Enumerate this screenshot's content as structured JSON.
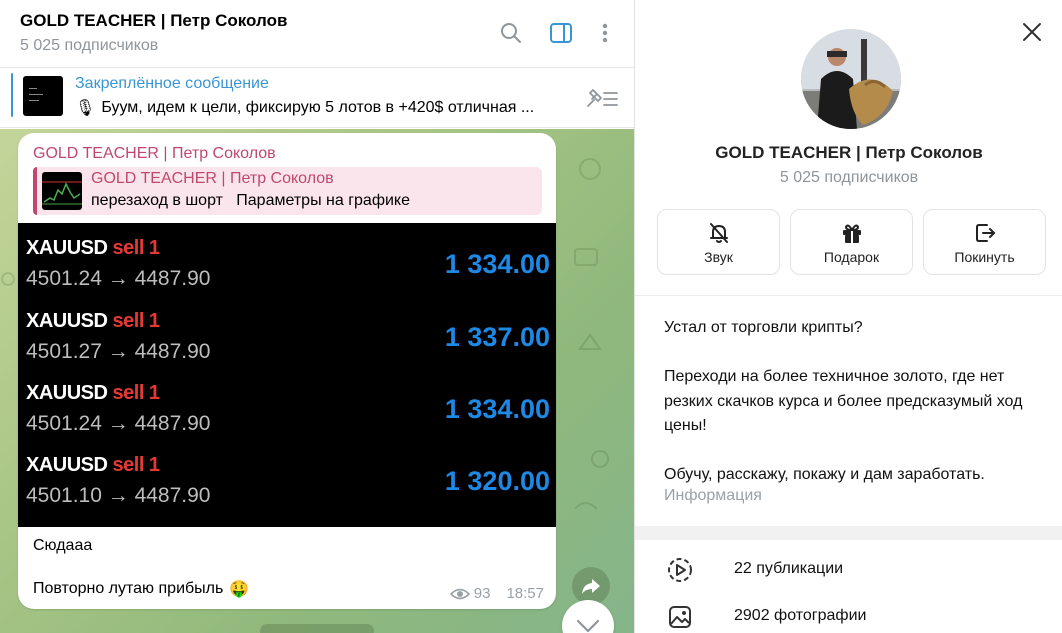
{
  "chat": {
    "title": "GOLD TEACHER | Петр Соколов",
    "subscribers": "5 025 подписчиков",
    "header_icons": [
      "search-icon",
      "sidebar-toggle-icon",
      "more-vert-icon"
    ]
  },
  "pinned": {
    "title": "Закреплённое сообщение",
    "text": "Буум, идем к цели, фиксирую 5 лотов в +420$   отличная ...",
    "emoji": "🎙"
  },
  "message": {
    "forwarded_from": "GOLD TEACHER | Петр Соколов",
    "reply": {
      "name": "GOLD TEACHER | Петр Соколов",
      "text": "перезаход в шорт   Параметры на графике"
    },
    "trades": [
      {
        "symbol": "XAUUSD",
        "side": "sell 1",
        "price": "4501.24 → 4487.90",
        "pnl": "1 334.00"
      },
      {
        "symbol": "XAUUSD",
        "side": "sell 1",
        "price": "4501.27 → 4487.90",
        "pnl": "1 337.00"
      },
      {
        "symbol": "XAUUSD",
        "side": "sell 1",
        "price": "4501.24 → 4487.90",
        "pnl": "1 334.00"
      },
      {
        "symbol": "XAUUSD",
        "side": "sell 1",
        "price": "4501.10 → 4487.90",
        "pnl": "1 320.00"
      }
    ],
    "text_line1": "Сюдааа",
    "text_line2": "Повторно лутаю прибыль",
    "text_emoji": "🤑",
    "views": "93",
    "time": "18:57"
  },
  "info": {
    "title": "GOLD TEACHER | Петр Соколов",
    "subscribers": "5 025 подписчиков",
    "actions": [
      {
        "label": "Звук",
        "icon": "bell-off-icon"
      },
      {
        "label": "Подарок",
        "icon": "gift-icon"
      },
      {
        "label": "Покинуть",
        "icon": "leave-icon"
      }
    ],
    "about": {
      "line1": "Устал от торговли крипты?",
      "line2": "Переходи на более техничное золото, где нет резких скачков курса и более предсказумый ход цены!",
      "line3": "Обучу, расскажу, покажу и дам заработать.",
      "label": "Информация"
    },
    "media": [
      {
        "label": "22 публикации",
        "icon": "publications-icon"
      },
      {
        "label": "2902 фотографии",
        "icon": "photo-icon"
      }
    ]
  },
  "colors": {
    "accent": "#3a95d5",
    "forward_name": "#c0486e",
    "sell": "#e53935",
    "pnl": "#1e88e5"
  }
}
